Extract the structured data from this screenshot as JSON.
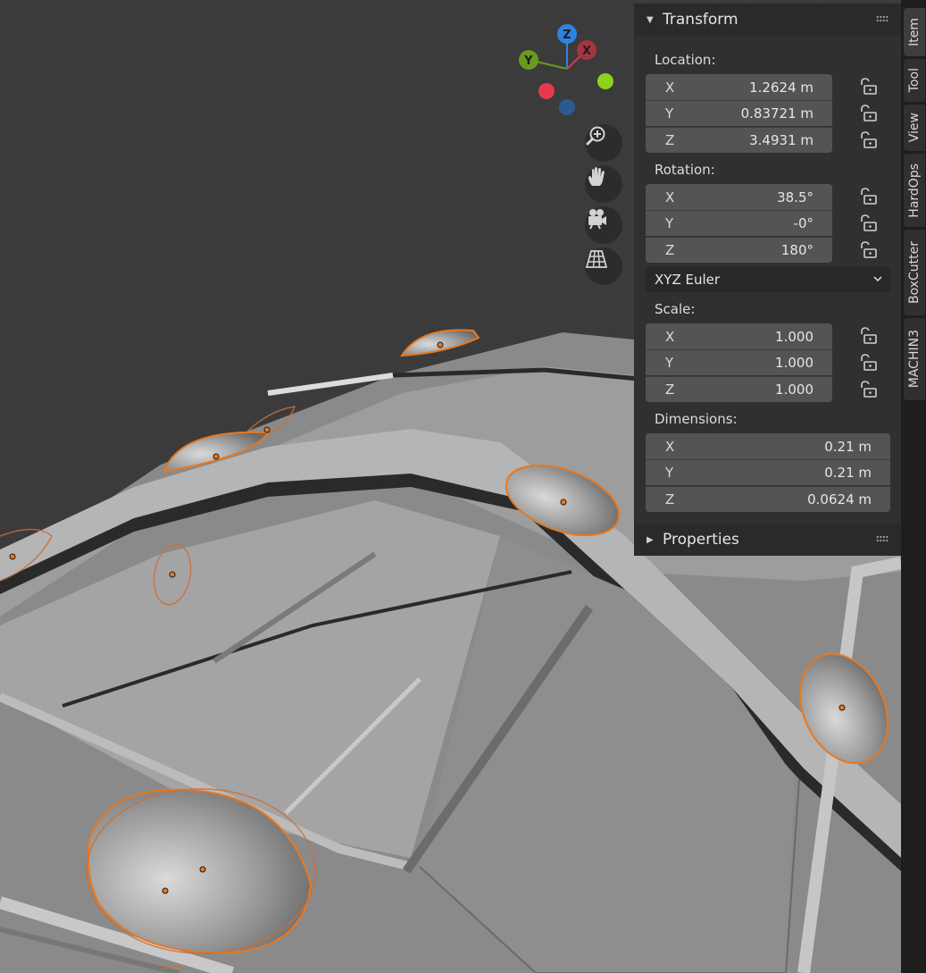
{
  "gizmo": {
    "z": "Z",
    "y": "Y",
    "x": "X"
  },
  "transform": {
    "title": "Transform",
    "location": {
      "label": "Location:",
      "x": {
        "axis": "X",
        "value": "1.2624 m"
      },
      "y": {
        "axis": "Y",
        "value": "0.83721 m"
      },
      "z": {
        "axis": "Z",
        "value": "3.4931 m"
      }
    },
    "rotation": {
      "label": "Rotation:",
      "x": {
        "axis": "X",
        "value": "38.5°"
      },
      "y": {
        "axis": "Y",
        "value": "-0°"
      },
      "z": {
        "axis": "Z",
        "value": "180°"
      },
      "mode": "XYZ Euler"
    },
    "scale": {
      "label": "Scale:",
      "x": {
        "axis": "X",
        "value": "1.000"
      },
      "y": {
        "axis": "Y",
        "value": "1.000"
      },
      "z": {
        "axis": "Z",
        "value": "1.000"
      }
    },
    "dimensions": {
      "label": "Dimensions:",
      "x": {
        "axis": "X",
        "value": "0.21 m"
      },
      "y": {
        "axis": "Y",
        "value": "0.21 m"
      },
      "z": {
        "axis": "Z",
        "value": "0.0624 m"
      }
    }
  },
  "properties": {
    "title": "Properties"
  },
  "tabs": [
    "Item",
    "Tool",
    "View",
    "HardOps",
    "BoxCutter",
    "MACHIN3"
  ],
  "colors": {
    "selection_outline": "#e8781e",
    "axis_x": "#d43c4c",
    "axis_y": "#6a9a1e",
    "axis_z": "#2f83e0"
  }
}
